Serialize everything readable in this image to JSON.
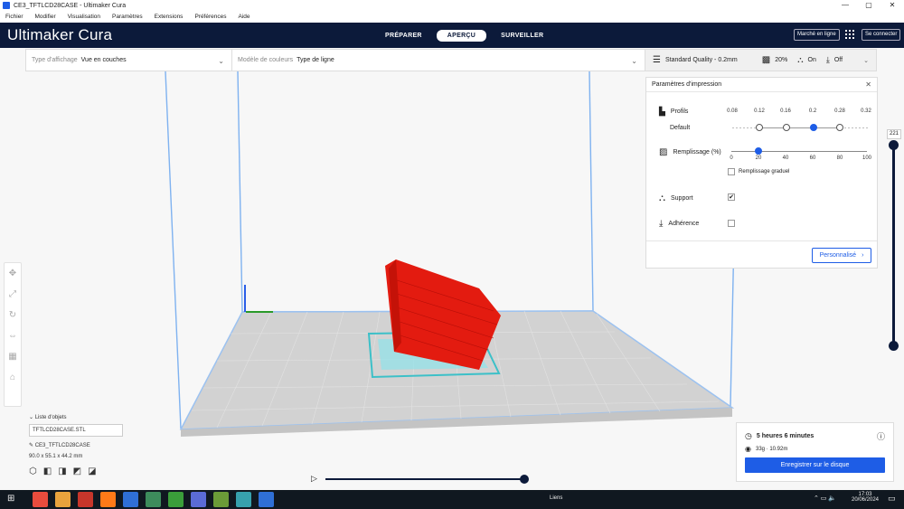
{
  "window": {
    "title": "CE3_TFTLCD28CASE - Ultimaker Cura",
    "controls": [
      "—",
      "▢",
      "✕"
    ]
  },
  "menu": [
    "Fichier",
    "Modifier",
    "Visualisation",
    "Paramètres",
    "Extensions",
    "Préférences",
    "Aide"
  ],
  "header": {
    "brand": "Ultimaker Cura",
    "stages": [
      "PRÉPARER",
      "APERÇU",
      "SURVEILLER"
    ],
    "active_stage": "APERÇU",
    "marketplace": "Marché en ligne",
    "signin": "Se connecter"
  },
  "toolbar": {
    "view_type_label": "Type d'affichage",
    "view_type_value": "Vue en couches",
    "color_model_label": "Modèle de couleurs",
    "color_model_value": "Type de ligne",
    "quality": "Standard Quality - 0.2mm",
    "infill": "20%",
    "support": "On",
    "adhesion": "Off"
  },
  "print_settings": {
    "title": "Paramètres d'impression",
    "profiles_label": "Profils",
    "profile_name": "Default",
    "layer_heights": [
      "0.08",
      "0.12",
      "0.16",
      "0.2",
      "0.28",
      "0.32"
    ],
    "selected_layer_height": "0.2",
    "infill_label": "Remplissage (%)",
    "infill_ticks": [
      "0",
      "20",
      "40",
      "60",
      "80",
      "100"
    ],
    "infill_value": 20,
    "gradual_infill_label": "Remplissage graduel",
    "gradual_infill": false,
    "support_label": "Support",
    "support_checked": true,
    "adhesion_label": "Adhérence",
    "adhesion_checked": false,
    "custom_button": "Personnalisé"
  },
  "layer_slider": {
    "value": "221"
  },
  "objects": {
    "header": "Liste d'objets",
    "file": "TFTLCD28CASE.STL",
    "name": "CE3_TFTLCD28CASE",
    "dims": "90.0 x 55.1 x 44.2 mm"
  },
  "estimate": {
    "time": "5 heures 6 minutes",
    "material": "33g · 10.92m",
    "save_button": "Enregistrer sur le disque"
  },
  "taskbar": {
    "links": "Liens",
    "time": "17:03",
    "date": "20/06/2024",
    "app_colors": [
      "#e84c3d",
      "#e8a33d",
      "#c7362b",
      "#ff7a18",
      "#2f6fd6",
      "#3d8c5c",
      "#3a9e3a",
      "#5b6bd6",
      "#6b9b38",
      "#37a1ad",
      "#2f6fd6"
    ]
  },
  "colors": {
    "accent": "#1e5de6",
    "header": "#0c1a3a",
    "model": "#e31b10",
    "support": "#6ad6e0",
    "bed": "#cfcfcf"
  }
}
